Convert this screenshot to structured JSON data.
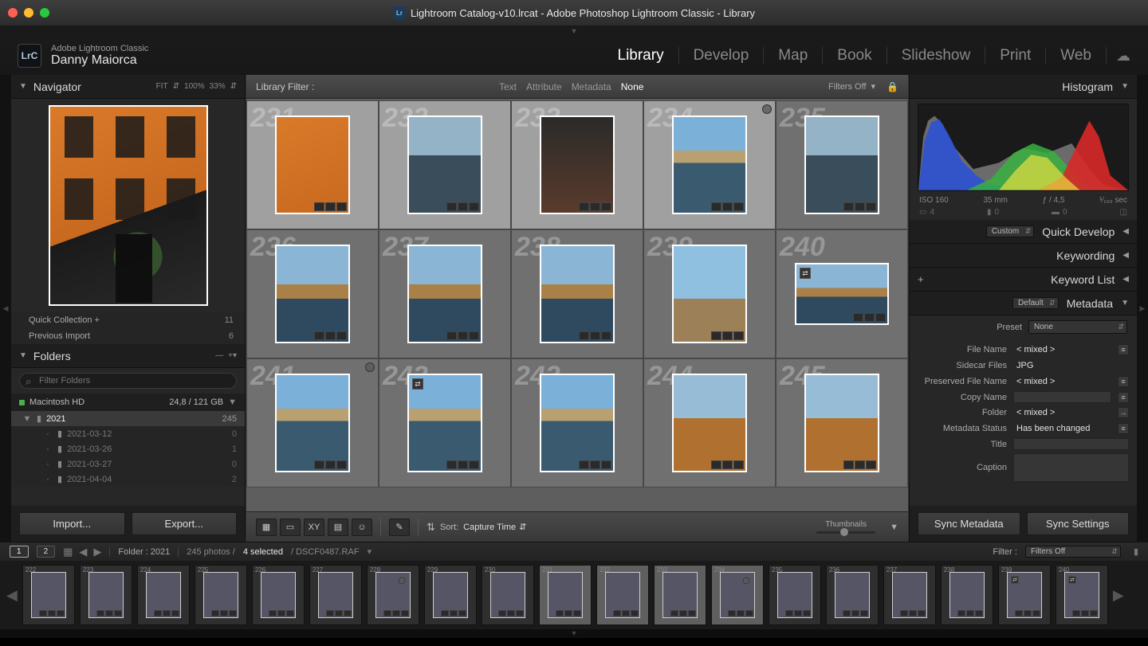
{
  "window": {
    "title": "Lightroom Catalog-v10.lrcat - Adobe Photoshop Lightroom Classic - Library"
  },
  "identity": {
    "product": "Adobe Lightroom Classic",
    "user": "Danny Maiorca",
    "badge": "LrC"
  },
  "modules": {
    "items": [
      "Library",
      "Develop",
      "Map",
      "Book",
      "Slideshow",
      "Print",
      "Web"
    ],
    "active": "Library"
  },
  "navigator": {
    "title": "Navigator",
    "zoom1": "FIT",
    "zoom2": "100%",
    "zoom3": "33%"
  },
  "catalog": {
    "rows": [
      {
        "label": "Quick Collection  +",
        "count": "11"
      },
      {
        "label": "Previous Import",
        "count": "6"
      }
    ]
  },
  "folders": {
    "title": "Folders",
    "filter_placeholder": "Filter Folders",
    "volume": {
      "name": "Macintosh HD",
      "space": "24,8 / 121 GB"
    },
    "tree": [
      {
        "name": "2021",
        "count": "245",
        "selected": true,
        "depth": 0,
        "expanded": true
      },
      {
        "name": "2021-03-12",
        "count": "0",
        "depth": 1
      },
      {
        "name": "2021-03-26",
        "count": "1",
        "depth": 1
      },
      {
        "name": "2021-03-27",
        "count": "0",
        "depth": 1
      },
      {
        "name": "2021-04-04",
        "count": "2",
        "depth": 1
      }
    ],
    "import": "Import...",
    "export": "Export..."
  },
  "library_filter": {
    "label": "Library Filter :",
    "tabs": [
      "Text",
      "Attribute",
      "Metadata",
      "None"
    ],
    "active": "None",
    "filters_off": "Filters Off"
  },
  "grid": {
    "start_index": 231,
    "cells": [
      {
        "idx": 231,
        "sel": true,
        "paint": "p-orange"
      },
      {
        "idx": 232,
        "sel": true,
        "paint": "p-blue"
      },
      {
        "idx": 233,
        "sel": true,
        "paint": "p-dark"
      },
      {
        "idx": 234,
        "sel": true,
        "paint": "p-river",
        "flag": true
      },
      {
        "idx": 235,
        "sel": false,
        "paint": "p-blue"
      },
      {
        "idx": 236,
        "paint": "p-canal"
      },
      {
        "idx": 237,
        "paint": "p-canal"
      },
      {
        "idx": 238,
        "paint": "p-canal"
      },
      {
        "idx": 239,
        "paint": "p-sky"
      },
      {
        "idx": 240,
        "paint": "p-canal",
        "landscape": true,
        "sync": true
      },
      {
        "idx": 241,
        "paint": "p-river",
        "flag": true
      },
      {
        "idx": 242,
        "paint": "p-river",
        "sync": true
      },
      {
        "idx": 243,
        "paint": "p-river"
      },
      {
        "idx": 244,
        "paint": "p-trees"
      },
      {
        "idx": 245,
        "paint": "p-trees"
      }
    ]
  },
  "toolbar": {
    "sort_label": "Sort:",
    "sort_value": "Capture Time",
    "thumbnails": "Thumbnails"
  },
  "right": {
    "histogram": "Histogram",
    "exif": {
      "iso": "ISO 160",
      "focal": "35 mm",
      "aperture": "ƒ / 4,5",
      "shutter": "¹⁄₁₆₀ sec",
      "count": "4",
      "flash": "0",
      "wb": "0"
    },
    "quick_develop": {
      "title": "Quick Develop",
      "preset": "Custom"
    },
    "keywording": "Keywording",
    "keyword_list": "Keyword List",
    "metadata": {
      "title": "Metadata",
      "mode": "Default",
      "preset_label": "Preset",
      "preset_value": "None",
      "rows": [
        {
          "l": "File Name",
          "v": "< mixed >",
          "btn": "≡"
        },
        {
          "l": "Sidecar Files",
          "v": "JPG"
        },
        {
          "l": "Preserved File Name",
          "v": "< mixed >",
          "btn": "≡"
        },
        {
          "l": "Copy Name",
          "v": "",
          "box": true,
          "btn": "≡"
        },
        {
          "l": "Folder",
          "v": "< mixed >",
          "btn": "→"
        },
        {
          "l": "Metadata Status",
          "v": "Has been changed",
          "btn": "≡"
        },
        {
          "l": "Title",
          "v": "",
          "box": true
        },
        {
          "l": "Caption",
          "v": "",
          "box": true,
          "tall": true
        }
      ]
    },
    "sync_metadata": "Sync Metadata",
    "sync_settings": "Sync Settings"
  },
  "lower_bar": {
    "d1": "1",
    "d2": "2",
    "breadcrumb": "Folder : 2021",
    "count": "245 photos /",
    "selected": "4 selected",
    "file": "/ DSCF0487.RAF",
    "filter_label": "Filter :",
    "filter_value": "Filters Off"
  },
  "filmstrip": {
    "start": 222,
    "items": [
      {
        "i": 222,
        "p": "p-river"
      },
      {
        "i": 223,
        "p": "p-river"
      },
      {
        "i": 224,
        "p": "p-blue"
      },
      {
        "i": 225,
        "p": "p-sky"
      },
      {
        "i": 226,
        "p": "p-blue"
      },
      {
        "i": 227,
        "p": "p-blue"
      },
      {
        "i": 228,
        "p": "p-blue",
        "flag": true
      },
      {
        "i": 229,
        "p": "p-dark"
      },
      {
        "i": 230,
        "p": "p-dark"
      },
      {
        "i": 231,
        "p": "p-orange",
        "sel": true
      },
      {
        "i": 232,
        "p": "p-blue",
        "sel": true
      },
      {
        "i": 233,
        "p": "p-dark",
        "sel": true
      },
      {
        "i": 234,
        "p": "p-river",
        "sel": true,
        "flag": true
      },
      {
        "i": 235,
        "p": "p-blue"
      },
      {
        "i": 236,
        "p": "p-canal"
      },
      {
        "i": 237,
        "p": "p-canal"
      },
      {
        "i": 238,
        "p": "p-canal"
      },
      {
        "i": 239,
        "p": "p-sky",
        "sync": true
      },
      {
        "i": 240,
        "p": "p-canal",
        "sync": true
      }
    ]
  }
}
